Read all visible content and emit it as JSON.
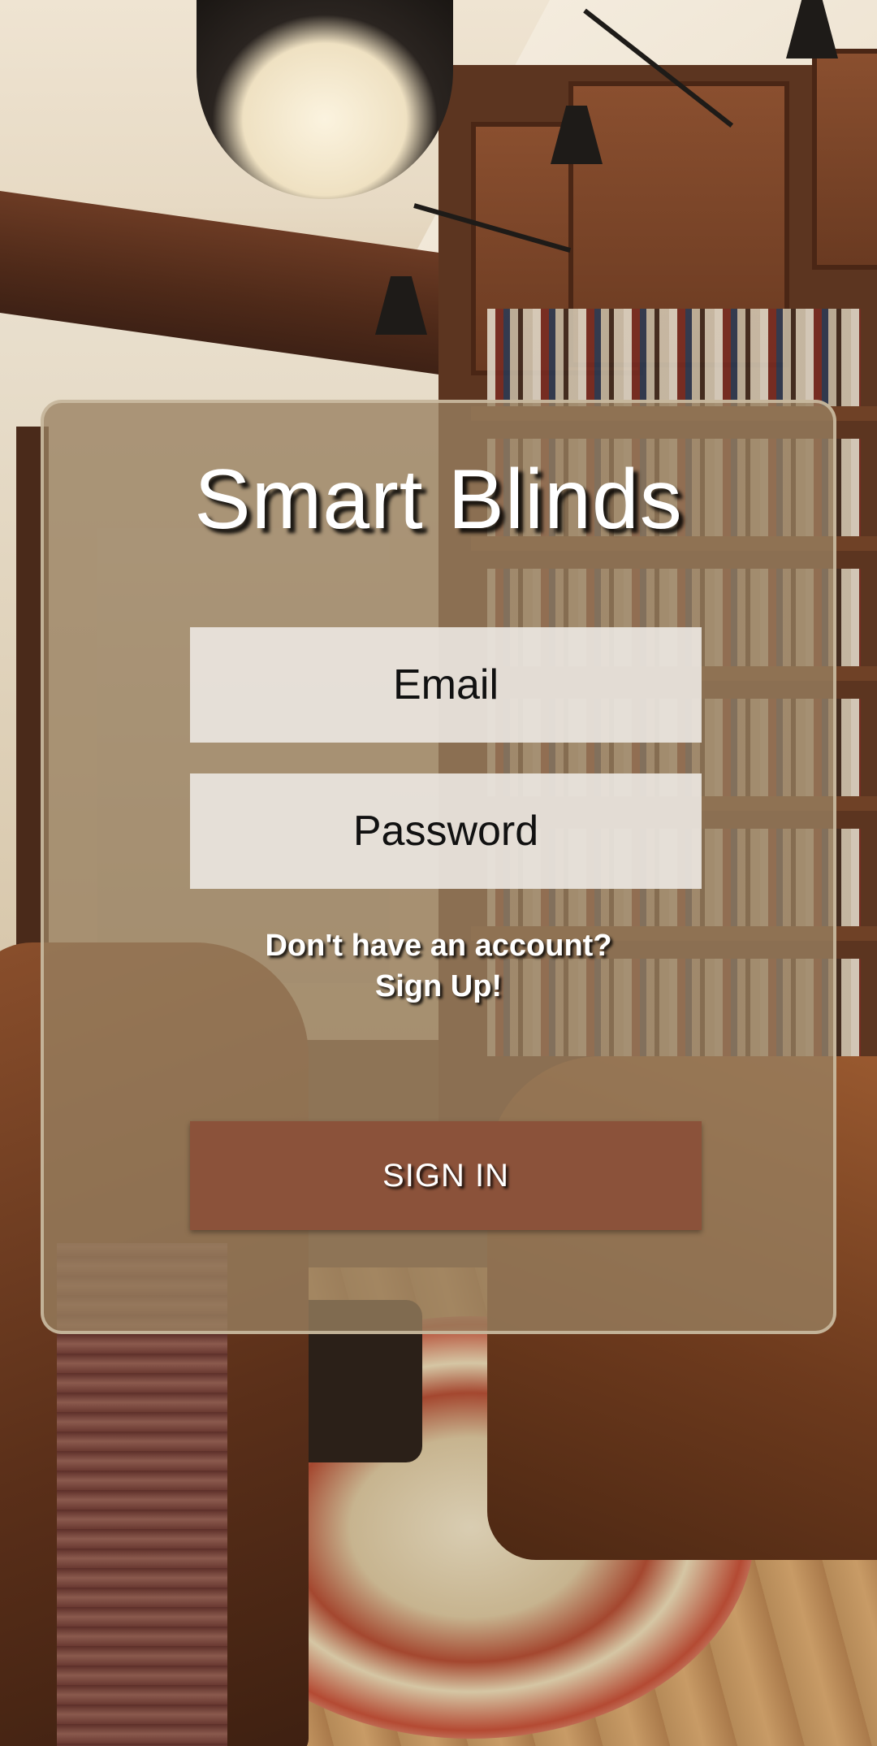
{
  "app": {
    "title": "Smart Blinds"
  },
  "login": {
    "email_placeholder": "Email",
    "password_placeholder": "Password",
    "signup_prompt": "Don't have an account?",
    "signup_link": "Sign Up!",
    "signin_label": "SIGN IN"
  },
  "colors": {
    "card_background": "#98805f",
    "button_background": "#8b523a",
    "text_light": "#ffffff",
    "field_background": "#ece8e2"
  }
}
